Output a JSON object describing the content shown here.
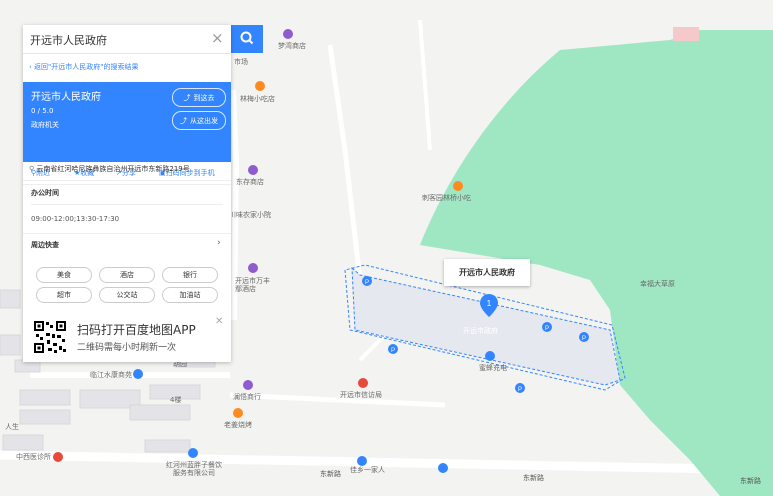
{
  "search": {
    "query": "开远市人民政府"
  },
  "panel": {
    "back_text": "返回\"开远市人民政府\"的搜索结果",
    "place": {
      "name": "开远市人民政府",
      "rating": "0 / 5.0",
      "category": "政府机关"
    },
    "buttons": {
      "goto": "到这去",
      "from": "从这出发"
    },
    "actions": {
      "nearby": "附近",
      "favorite": "收藏",
      "share": "分享",
      "send_phone": "扫码同步到手机"
    },
    "address": "云南省红河哈尼族彝族自治州开远市东新路219号",
    "hours_title": "办公时间",
    "hours": "09:00-12:00;13:30-17:30",
    "nearby_title": "周边快查",
    "chips": [
      "美食",
      "酒店",
      "银行",
      "超市",
      "公交站",
      "加油站"
    ]
  },
  "qr_card": {
    "title": "扫码打开百度地图APP",
    "subtitle": "二维码需每小时刷新一次"
  },
  "map": {
    "popup": "开远市人民政府",
    "area_label": "开远市政府",
    "charger": "蜜蜂充电",
    "park": "幸福大草原",
    "pois": {
      "mengwan": "梦湾商店",
      "market": "市场",
      "linmei": "林梅小吃店",
      "dongcun": "东存商店",
      "nongjia": "川味农家小院",
      "wanfeng": "开远市万丰\n鄢酒店",
      "qiaoqiao": "刺客园林桥小吃",
      "linjiang": "临江水康商苑",
      "lanwu": "澜悟商行",
      "laomei": "老姜烧烤",
      "xinfang": "开远市信访局",
      "baozi": "红河州蓝胖子餐饮\n服务有限公司",
      "clinic": "中西医诊所",
      "ren": "人生",
      "jiaxiang": "佳乡一家人",
      "lou": "4楼",
      "yuan": "胡园"
    },
    "roads": [
      "东新路",
      "东新路",
      "东新路"
    ],
    "accent": "#3385ff",
    "green": "#9fe6c3"
  }
}
